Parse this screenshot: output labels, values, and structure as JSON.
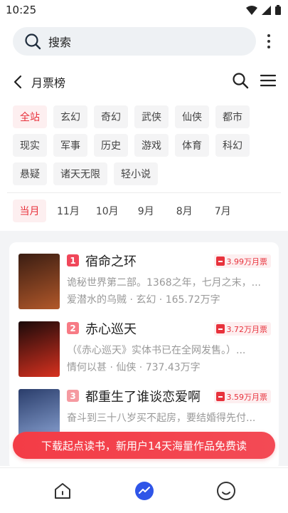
{
  "status": {
    "time": "10:25"
  },
  "search": {
    "label": "搜索"
  },
  "header": {
    "title": "月票榜"
  },
  "categories": [
    "全站",
    "玄幻",
    "奇幻",
    "武侠",
    "仙侠",
    "都市",
    "现实",
    "军事",
    "历史",
    "游戏",
    "体育",
    "科幻",
    "悬疑",
    "诸天无限",
    "轻小说"
  ],
  "active_category": "全站",
  "periods": [
    "当月",
    "11月",
    "10月",
    "9月",
    "8月",
    "7月"
  ],
  "active_period": "当月",
  "books": [
    {
      "rank": "1",
      "rank_color": "#f0475a",
      "name": "宿命之环",
      "votes": "3.99万月票",
      "desc": "诡秘世界第二部。1368之年，七月之末，...",
      "meta": "爱潜水的乌贼 · 玄幻 · 165.72万字",
      "cover_colors": [
        "#3a1d12",
        "#b2582a"
      ]
    },
    {
      "rank": "2",
      "rank_color": "#f77b85",
      "name": "赤心巡天",
      "votes": "3.72万月票",
      "desc": "（《赤心巡天》实体书已在全网发售。）...",
      "meta": "情何以甚 · 仙侠 · 737.43万字",
      "cover_colors": [
        "#1a0a0a",
        "#d8311f"
      ]
    },
    {
      "rank": "3",
      "rank_color": "#f59aa1",
      "name": "都重生了谁谈恋爱啊",
      "votes": "3.59万月票",
      "desc": "奋斗到三十八岁买不起房，要结婚得先付...",
      "meta": "",
      "cover_colors": [
        "#2a3d6b",
        "#8fa8d8"
      ]
    }
  ],
  "banner": {
    "text": "下载起点读书，新用户14天海量作品免费读"
  },
  "colors": {
    "accent": "#e8323c",
    "chip_bg": "#f4f4f5",
    "active_chip_bg": "#fdeff0"
  }
}
